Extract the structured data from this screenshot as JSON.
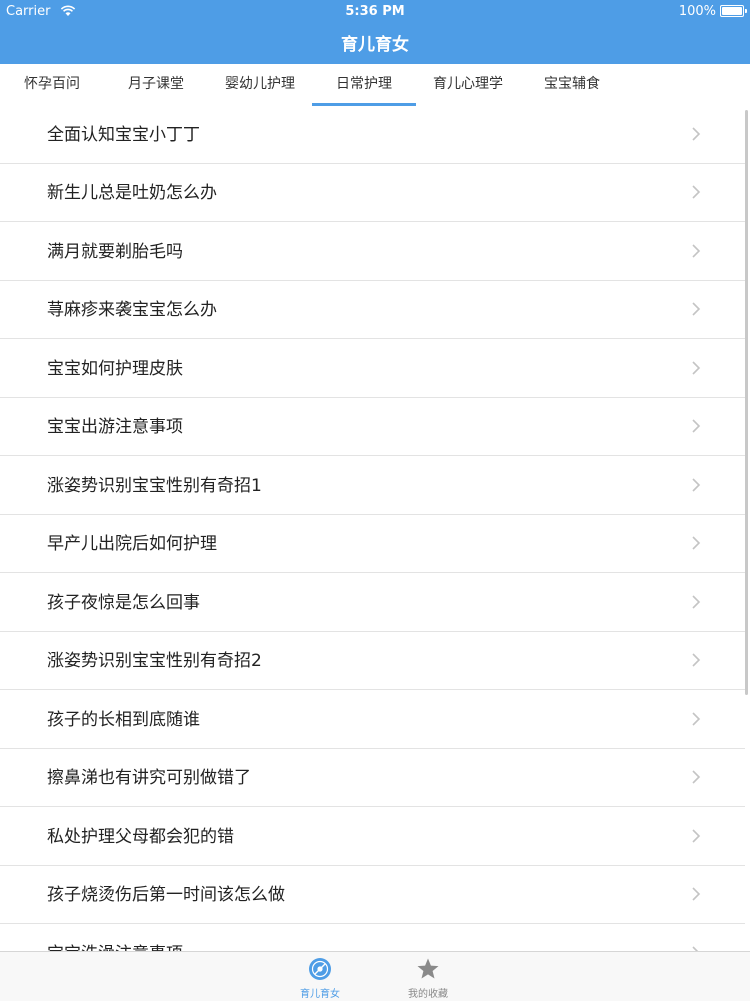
{
  "status_bar": {
    "carrier": "Carrier",
    "time": "5:36 PM",
    "battery": "100%"
  },
  "nav": {
    "title": "育儿育女"
  },
  "tabs": [
    {
      "label": "怀孕百问",
      "active": false
    },
    {
      "label": "月子课堂",
      "active": false
    },
    {
      "label": "婴幼儿护理",
      "active": false
    },
    {
      "label": "日常护理",
      "active": true
    },
    {
      "label": "育儿心理学",
      "active": false
    },
    {
      "label": "宝宝辅食",
      "active": false
    }
  ],
  "list_items": [
    "全面认知宝宝小丁丁",
    "新生儿总是吐奶怎么办",
    "满月就要剃胎毛吗",
    "荨麻疹来袭宝宝怎么办",
    "宝宝如何护理皮肤",
    "宝宝出游注意事项",
    "涨姿势识别宝宝性别有奇招1",
    "早产儿出院后如何护理",
    "孩子夜惊是怎么回事",
    "涨姿势识别宝宝性别有奇招2",
    "孩子的长相到底随谁",
    "擦鼻涕也有讲究可别做错了",
    "私处护理父母都会犯的错",
    "孩子烧烫伤后第一时间该怎么做",
    "宝宝洗澡注意事项"
  ],
  "tab_bar": [
    {
      "label": "育儿育女",
      "icon": "disc-icon",
      "active": true
    },
    {
      "label": "我的收藏",
      "icon": "star-icon",
      "active": false
    }
  ],
  "colors": {
    "accent": "#4e9de6",
    "inactive": "#8a8a8a"
  }
}
